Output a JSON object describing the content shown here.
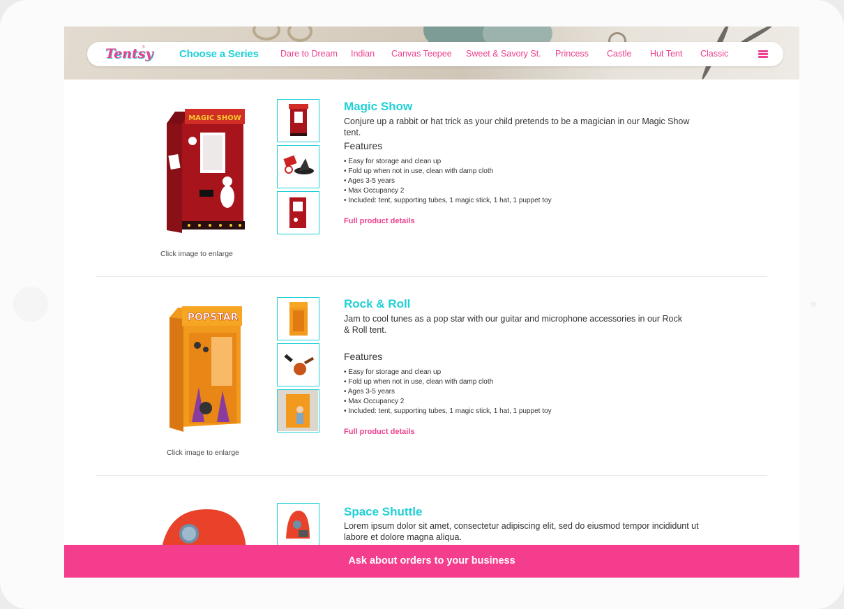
{
  "header": {
    "logo_text": "Tentsy",
    "logo_reg": "®",
    "choose_label": "Choose a Series",
    "nav_items": [
      "Dare to Dream",
      "Indian",
      "Canvas Teepee",
      "Sweet & Savory St.",
      "Princess",
      "Castle",
      "Hut Tent",
      "Classic"
    ],
    "menu_icon": "hamburger-menu-icon"
  },
  "products": [
    {
      "title": "Magic Show",
      "description": "Conjure up a rabbit or hat trick as your child pretends to be a magician in our Magic Show tent.",
      "features_heading": "Features",
      "features": [
        "• Easy for storage and clean up",
        "• Fold up when not in use, clean with damp cloth",
        "• Ages 3-5 years",
        "• Max Occupancy 2",
        "• Included: tent, supporting tubes, 1 magic stick, 1 hat, 1 puppet toy"
      ],
      "details_label": "Full product details",
      "caption": "Click image to enlarge",
      "sign_text": "MAGIC SHOW"
    },
    {
      "title": "Rock & Roll",
      "description": "Jam to cool tunes as a pop star with our guitar and microphone accessories in our Rock & Roll tent.",
      "features_heading": "Features",
      "features": [
        "• Easy for storage and clean up",
        "• Fold up when not in use, clean with damp cloth",
        "• Ages 3-5 years",
        "• Max Occupancy 2",
        "• Included: tent, supporting tubes, 1 magic stick, 1 hat, 1 puppet toy"
      ],
      "details_label": "Full product details",
      "caption": "Click image to enlarge",
      "sign_text": "POPSTAR"
    },
    {
      "title": "Space Shuttle",
      "description": "Lorem ipsum dolor sit amet, consectetur adipiscing elit, sed do eiusmod tempor incididunt ut labore et dolore magna aliqua."
    }
  ],
  "cta": {
    "label": "Ask about orders to your business"
  },
  "colors": {
    "accent_pink": "#ed3f8d",
    "accent_cyan": "#1fd0d6",
    "cta_bg": "#f43d8c"
  }
}
